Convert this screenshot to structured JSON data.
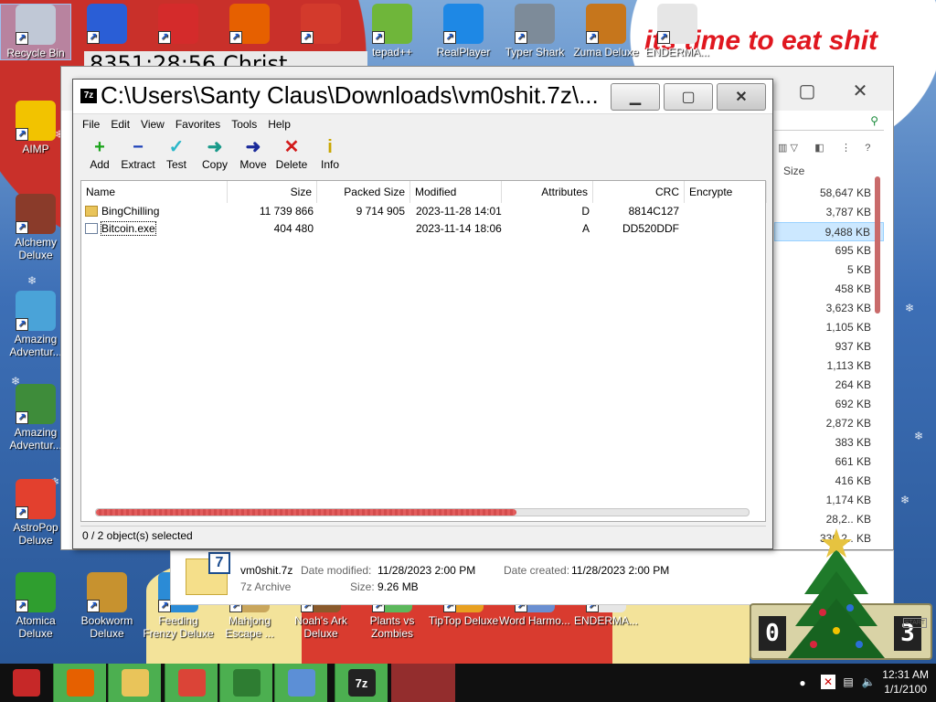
{
  "desktop": {
    "speech_text": "its time to eat shit",
    "counter_text": "8351:28:56 Christ",
    "top_icons": [
      {
        "label": "Recycle Bin",
        "icon": "recycle-bin-icon",
        "color": "#c0c8d6"
      },
      {
        "label": "",
        "icon": "zuma-icon",
        "color": "#2a5ed6"
      },
      {
        "label": "",
        "icon": "red-puffball-icon",
        "color": "#d42b2b"
      },
      {
        "label": "",
        "icon": "firefox-icon",
        "color": "#e66000"
      },
      {
        "label": "",
        "icon": "torii-gate-icon",
        "color": "#d33a2c"
      },
      {
        "label": "tepad++",
        "icon": "notepadpp-icon",
        "color": "#6fb63a"
      },
      {
        "label": "RealPlayer",
        "icon": "realplayer-icon",
        "color": "#1e88e5"
      },
      {
        "label": "Typer Shark",
        "icon": "shark-icon",
        "color": "#7d8b99"
      },
      {
        "label": "Zuma Deluxe",
        "icon": "zuma-deluxe-icon",
        "color": "#c6761c"
      },
      {
        "label": "ENDERMA...",
        "icon": "window-app-icon",
        "color": "#e6e6e6"
      }
    ],
    "left_icons": [
      {
        "label": "AIMP",
        "icon": "aimp-icon",
        "color": "#f2c300"
      },
      {
        "label": "Alchemy Deluxe",
        "icon": "wizard-icon",
        "color": "#8a3b2a"
      },
      {
        "label": "Amazing Adventur...",
        "icon": "gem-icon",
        "color": "#4aa3d8"
      },
      {
        "label": "Amazing Adventur...",
        "icon": "globe-icon",
        "color": "#3e8c3a"
      },
      {
        "label": "AstroPop Deluxe",
        "icon": "astropop-icon",
        "color": "#e3402e"
      },
      {
        "label": "Atomica Deluxe",
        "icon": "atomica-icon",
        "color": "#2f9e2f"
      }
    ],
    "bottom_icons": [
      {
        "label": "Bookworm Deluxe",
        "icon": "bookworm-icon",
        "color": "#c7922f"
      },
      {
        "label": "Feeding Frenzy Deluxe",
        "icon": "fish-icon",
        "color": "#2b8bd6"
      },
      {
        "label": "Mahjong Escape ...",
        "icon": "mahjong-icon",
        "color": "#c9a65c"
      },
      {
        "label": "Noah's Ark Deluxe",
        "icon": "ark-icon",
        "color": "#8a5a2b"
      },
      {
        "label": "Plants vs Zombies",
        "icon": "plant-icon",
        "color": "#5cb85c"
      },
      {
        "label": "TipTop Deluxe",
        "icon": "tiptop-icon",
        "color": "#e8a020"
      },
      {
        "label": "Word Harmo...",
        "icon": "word-icon",
        "color": "#6a8fd1"
      },
      {
        "label": "ENDERMA...",
        "icon": "window-app-icon",
        "color": "#e6e6e6"
      }
    ]
  },
  "explorer": {
    "size_header": "Size",
    "sizes": [
      "58,647 KB",
      "3,787 KB",
      "9,488 KB",
      "695 KB",
      "5 KB",
      "458 KB",
      "3,623 KB",
      "1,105 KB",
      "937 KB",
      "1,113 KB",
      "264 KB",
      "692 KB",
      "2,872 KB",
      "383 KB",
      "661 KB",
      "416 KB",
      "1,174 KB",
      "28,2.. KB",
      "336,2.. KB"
    ],
    "highlight_index": 2,
    "details": {
      "name": "vm0shit.7z",
      "type": "7z Archive",
      "modified_label": "Date modified:",
      "modified_value": "11/28/2023 2:00 PM",
      "created_label": "Date created:",
      "created_value": "11/28/2023 2:00 PM",
      "size_label": "Size:",
      "size_value": "9.26 MB",
      "icon_label": "7"
    }
  },
  "sevenzip": {
    "app_icon": "7z",
    "title": "C:\\Users\\Santy Claus\\Downloads\\vm0shit.7z\\...",
    "menu": [
      "File",
      "Edit",
      "View",
      "Favorites",
      "Tools",
      "Help"
    ],
    "toolbar": [
      {
        "label": "Add",
        "glyph": "+",
        "color": "#1aa31a",
        "name": "add-button",
        "icon": "plus-icon"
      },
      {
        "label": "Extract",
        "glyph": "−",
        "color": "#1a3fb8",
        "name": "extract-button",
        "icon": "minus-icon"
      },
      {
        "label": "Test",
        "glyph": "✓",
        "color": "#2bb7c9",
        "name": "test-button",
        "icon": "check-icon"
      },
      {
        "label": "Copy",
        "glyph": "➜",
        "color": "#1a9a8a",
        "name": "copy-button",
        "icon": "arrow-right-icon"
      },
      {
        "label": "Move",
        "glyph": "➜",
        "color": "#1a2a9a",
        "name": "move-button",
        "icon": "arrow-right-icon"
      },
      {
        "label": "Delete",
        "glyph": "✕",
        "color": "#d21a1a",
        "name": "delete-button",
        "icon": "delete-x-icon"
      },
      {
        "label": "Info",
        "glyph": "i",
        "color": "#c9a600",
        "name": "info-button",
        "icon": "info-icon"
      }
    ],
    "columns": [
      "Name",
      "Size",
      "Packed Size",
      "Modified",
      "Attributes",
      "CRC",
      "Encrypte"
    ],
    "rows": [
      {
        "name": "BingChilling",
        "type": "folder",
        "size": "11 739 866",
        "packed": "9 714 905",
        "modified": "2023-11-28 14:01",
        "attributes": "D",
        "crc": "8814C127"
      },
      {
        "name": "Bitcoin.exe",
        "type": "exe",
        "size": "404 480",
        "packed": "",
        "modified": "2023-11-14 18:06",
        "attributes": "A",
        "crc": "DD520DDF"
      }
    ],
    "status": "0 / 2 object(s) selected"
  },
  "gadget": {
    "digits": [
      "0",
      "",
      "",
      "3"
    ],
    "badge": "START"
  },
  "taskbar": {
    "buttons": [
      {
        "name": "start-button",
        "icon": "santa-icon",
        "color": "#c62828"
      },
      {
        "name": "taskbar-firefox",
        "icon": "firefox-icon",
        "color": "#e66000"
      },
      {
        "name": "taskbar-explorer",
        "icon": "folder-icon",
        "color": "#e9c45a"
      },
      {
        "name": "taskbar-chrome",
        "icon": "chrome-icon",
        "color": "#db4437"
      },
      {
        "name": "taskbar-tree-app",
        "icon": "tree-icon",
        "color": "#2e7d32"
      },
      {
        "name": "taskbar-photos",
        "icon": "photo-icon",
        "color": "#5c8fd6"
      },
      {
        "name": "taskbar-7zip",
        "icon": "sevenzip-icon",
        "color": "#222222"
      }
    ],
    "sevenzip_label": "7z",
    "time": "12:31 AM",
    "date": "1/1/2100"
  }
}
